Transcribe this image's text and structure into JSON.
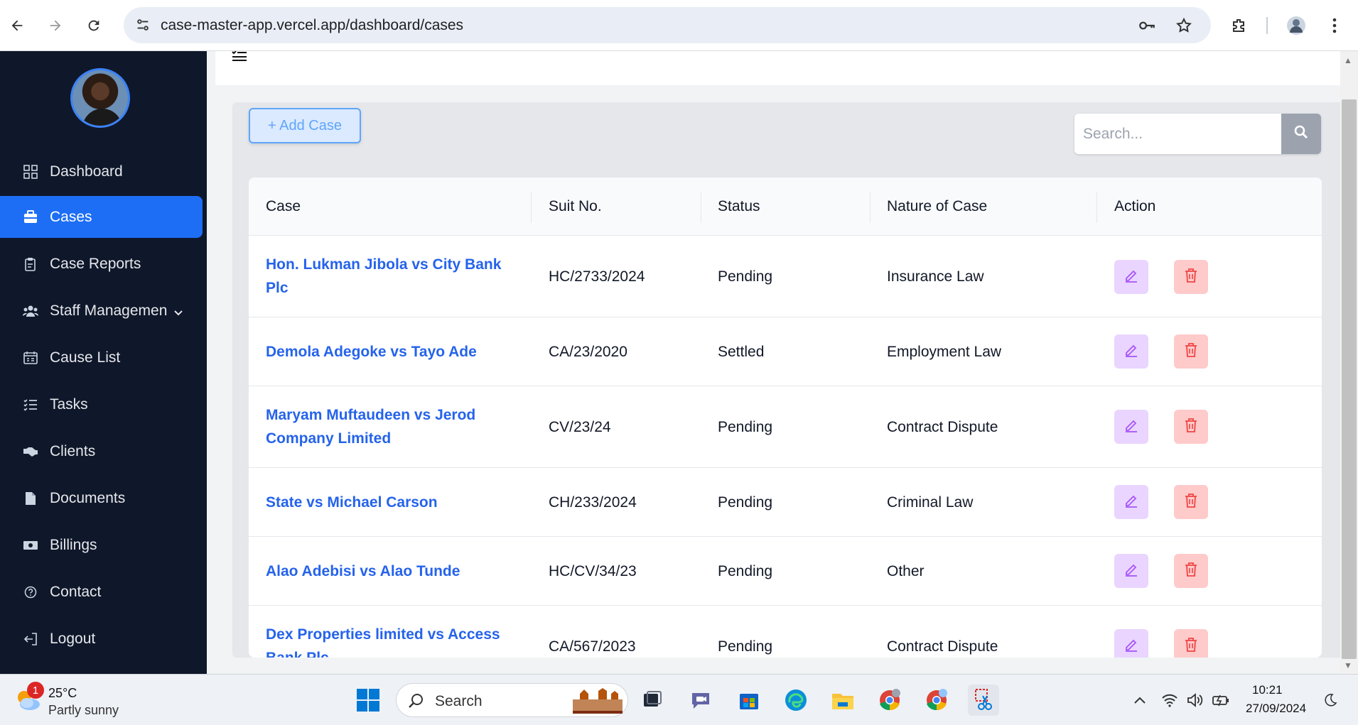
{
  "browser": {
    "url": "case-master-app.vercel.app/dashboard/cases"
  },
  "sidebar": {
    "items": [
      {
        "label": "Dashboard",
        "icon": "dashboard-grid-icon"
      },
      {
        "label": "Cases",
        "icon": "briefcase-icon",
        "active": true
      },
      {
        "label": "Case Reports",
        "icon": "clipboard-report-icon"
      },
      {
        "label": "Staff Managemen",
        "icon": "users-icon",
        "has_dropdown": true
      },
      {
        "label": "Cause List",
        "icon": "calendar-list-icon"
      },
      {
        "label": "Tasks",
        "icon": "task-list-icon"
      },
      {
        "label": "Clients",
        "icon": "handshake-icon"
      },
      {
        "label": "Documents",
        "icon": "document-icon"
      },
      {
        "label": "Billings",
        "icon": "money-icon"
      },
      {
        "label": "Contact",
        "icon": "help-circle-icon"
      },
      {
        "label": "Logout",
        "icon": "logout-icon"
      }
    ]
  },
  "toolbar": {
    "add_case_label": "+ Add Case",
    "search_placeholder": "Search..."
  },
  "table": {
    "headers": [
      "Case",
      "Suit No.",
      "Status",
      "Nature of Case",
      "Action"
    ],
    "rows": [
      {
        "case": "Hon. Lukman Jibola vs City Bank Plc",
        "case_line1": "Hon. Lukman Jibola vs City Bank",
        "case_line2": "Plc",
        "suit_no": "HC/2733/2024",
        "status": "Pending",
        "nature": "Insurance Law"
      },
      {
        "case": "Demola Adegoke vs Tayo Ade",
        "case_line1": "Demola Adegoke vs Tayo Ade",
        "case_line2": "",
        "suit_no": "CA/23/2020",
        "status": "Settled",
        "nature": "Employment Law"
      },
      {
        "case": "Maryam Muftaudeen vs Jerod Company Limited",
        "case_line1": "Maryam Muftaudeen vs Jerod",
        "case_line2": "Company Limited",
        "suit_no": "CV/23/24",
        "status": "Pending",
        "nature": "Contract Dispute"
      },
      {
        "case": "State vs Michael Carson",
        "case_line1": "State vs Michael Carson",
        "case_line2": "",
        "suit_no": "CH/233/2024",
        "status": "Pending",
        "nature": "Criminal Law"
      },
      {
        "case": "Alao Adebisi vs Alao Tunde",
        "case_line1": "Alao Adebisi vs Alao Tunde",
        "case_line2": "",
        "suit_no": "HC/CV/34/23",
        "status": "Pending",
        "nature": "Other"
      },
      {
        "case": "Dex Properties limited vs Access Bank Plc",
        "case_line1": "Dex Properties limited vs Access",
        "case_line2": "Bank Plc",
        "suit_no": "CA/567/2023",
        "status": "Pending",
        "nature": "Contract Dispute"
      }
    ]
  },
  "taskbar": {
    "weather_temp": "25°C",
    "weather_desc": "Partly sunny",
    "weather_badge": "1",
    "search_label": "Search",
    "time": "10:21",
    "date": "27/09/2024"
  },
  "colors": {
    "sidebar_bg": "#0f172a",
    "active_item": "#1d6ef5",
    "link": "#2563eb",
    "edit_bg": "#e9d5ff",
    "delete_bg": "#fecaca"
  }
}
